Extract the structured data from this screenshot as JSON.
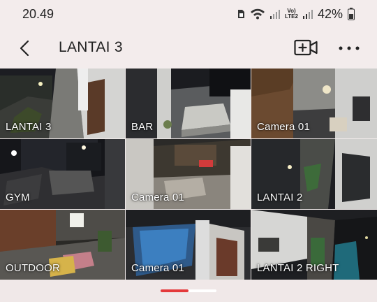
{
  "status_bar": {
    "time": "20.49",
    "network_label": "Vo)\nLTE2",
    "battery_percent": "42%",
    "icons": [
      "sim-icon",
      "wifi-icon",
      "signal-icon",
      "signal-icon",
      "battery-icon"
    ]
  },
  "app_bar": {
    "title": "LANTAI 3",
    "back_icon": "chevron-left-icon",
    "add_camera_icon": "add-camera-icon",
    "more_icon": "more-dots-icon"
  },
  "cameras": [
    {
      "label": "LANTAI 3",
      "selected": true
    },
    {
      "label": "BAR",
      "selected": false
    },
    {
      "label": "Camera 01",
      "selected": false
    },
    {
      "label": "GYM",
      "selected": false
    },
    {
      "label": "Camera 01",
      "selected": false
    },
    {
      "label": "LANTAI 2",
      "selected": false
    },
    {
      "label": "OUTDOOR",
      "selected": false
    },
    {
      "label": "Camera 01",
      "selected": false
    },
    {
      "label": "LANTAI 2 RIGHT",
      "selected": false
    }
  ],
  "colors": {
    "accent": "#e4393b",
    "background": "#f3ecec"
  }
}
